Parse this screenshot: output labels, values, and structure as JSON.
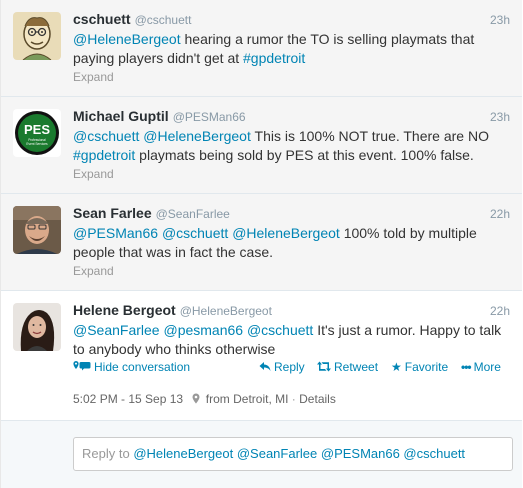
{
  "tweets": [
    {
      "fullname": "cschuett",
      "username": "@cschuett",
      "time": "23h",
      "text_parts": {
        "m1": "@HeleneBergeot",
        "p1": " hearing a rumor the TO is selling playmats that paying players didn't get at ",
        "h1": "#gpdetroit"
      },
      "expand": "Expand"
    },
    {
      "fullname": "Michael Guptil",
      "username": "@PESMan66",
      "time": "23h",
      "avatar_text": "PES",
      "avatar_sub": "Professional Event Services",
      "text_parts": {
        "m1": "@cschuett",
        "m2": "@HeleneBergeot",
        "p1": " This is 100% NOT true.  There are NO ",
        "h1": "#gpdetroit",
        "p2": " playmats being sold by PES at this event.  100% false."
      },
      "expand": "Expand"
    },
    {
      "fullname": "Sean Farlee",
      "username": "@SeanFarlee",
      "time": "22h",
      "text_parts": {
        "m1": "@PESMan66",
        "m2": "@cschuett",
        "m3": "@HeleneBergeot",
        "p1": " 100% told by multiple people that was in fact the case."
      },
      "expand": "Expand"
    },
    {
      "fullname": "Helene Bergeot",
      "username": "@HeleneBergeot",
      "time": "22h",
      "text_parts": {
        "m1": "@SeanFarlee",
        "m2": "@pesman66",
        "m3": "@cschuett",
        "p1": " It's just a rumor. Happy to talk to anybody who thinks otherwise"
      },
      "actions": {
        "hide": "Hide conversation",
        "reply": "Reply",
        "retweet": "Retweet",
        "favorite": "Favorite",
        "more": "More"
      },
      "meta": {
        "datetime": "5:02 PM - 15 Sep 13",
        "location": "from Detroit, MI",
        "details": "Details"
      },
      "reply_box": {
        "prefix": "Reply to ",
        "mentions": "@HeleneBergeot @SeanFarlee @PESMan66 @cschuett"
      }
    }
  ],
  "colors": {
    "link": "#0084b4",
    "muted": "#8899a6",
    "pes_green": "#1a7a2e"
  },
  "icons": {
    "geo": "map-pin-icon",
    "conversation": "conversation-icon",
    "reply": "reply-arrow-icon",
    "retweet": "retweet-icon",
    "favorite": "star-icon",
    "more": "dots-icon"
  }
}
